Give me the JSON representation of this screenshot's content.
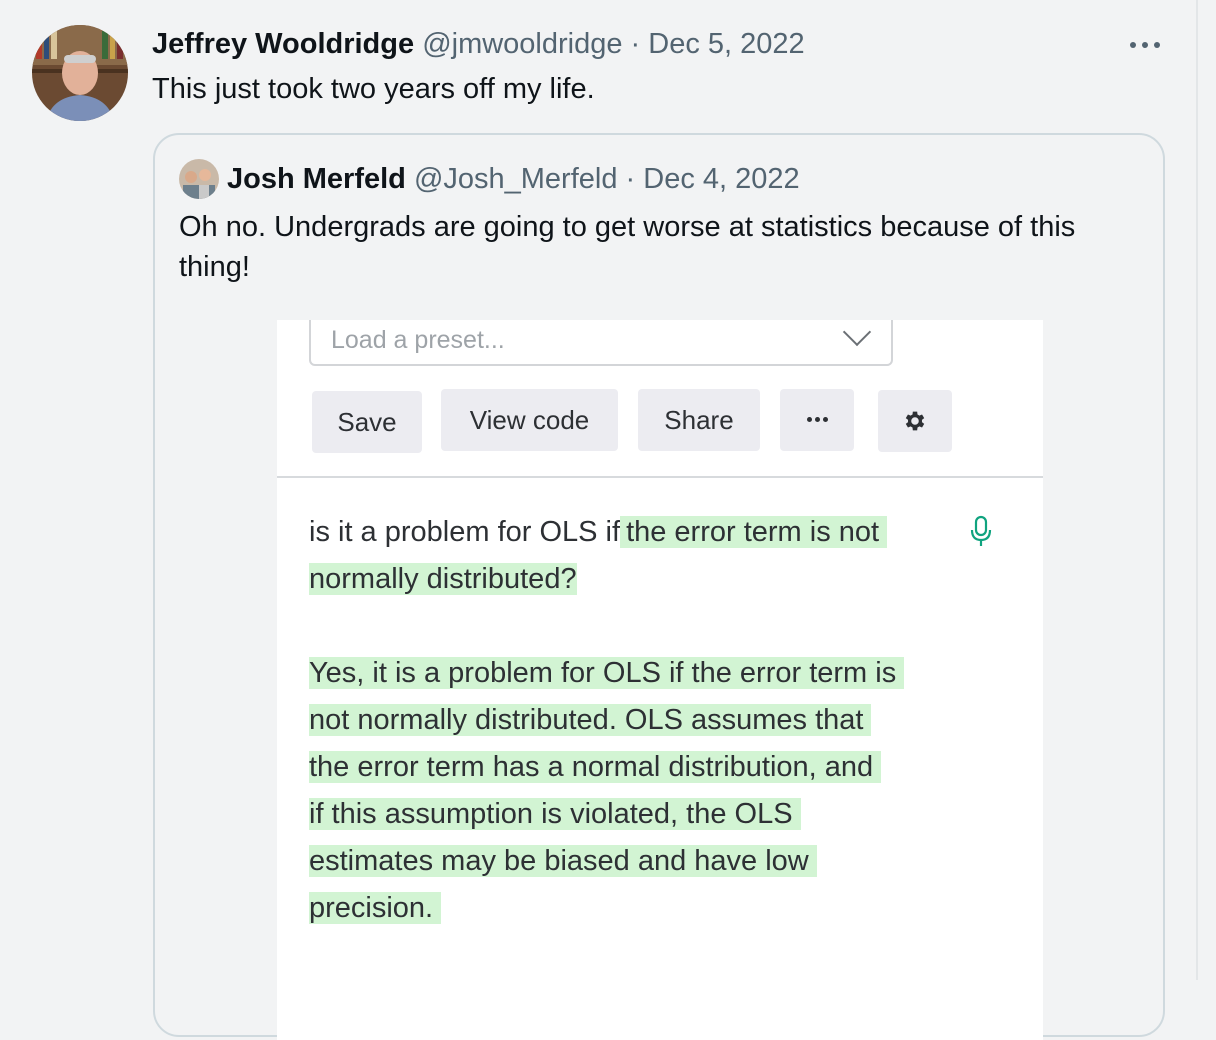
{
  "tweet": {
    "author_name": "Jeffrey Wooldridge",
    "author_handle": "@jmwooldridge",
    "separator": "·",
    "date": "Dec 5, 2022",
    "text": "This just took two years off my life."
  },
  "quoted_tweet": {
    "author_name": "Josh Merfeld",
    "author_handle": "@Josh_Merfeld",
    "separator": "·",
    "date": "Dec 4, 2022",
    "text": "Oh no. Undergrads are going to get worse at statistics because of this thing!"
  },
  "embedded_screenshot": {
    "preset_placeholder": "Load a preset...",
    "buttons": {
      "save": "Save",
      "view_code": "View code",
      "share": "Share"
    },
    "prompt_plain": "is it a problem for OLS if",
    "prompt_highlight_1": "the error term is not",
    "prompt_highlight_2": "normally distributed?",
    "answer_lines": [
      "Yes, it is a problem for OLS if the error term is",
      "not normally distributed. OLS assumes that",
      "the error term has a normal distribution, and",
      "if this assumption is violated, the OLS",
      "estimates may be biased and have low",
      "precision."
    ],
    "highlight_color": "#d2f4d3",
    "mic_color": "#10a37f"
  },
  "colors": {
    "page_bg": "#f2f3f4",
    "primary_text": "#0f1419",
    "secondary_text": "#536471",
    "quote_border": "#cfd9de"
  }
}
